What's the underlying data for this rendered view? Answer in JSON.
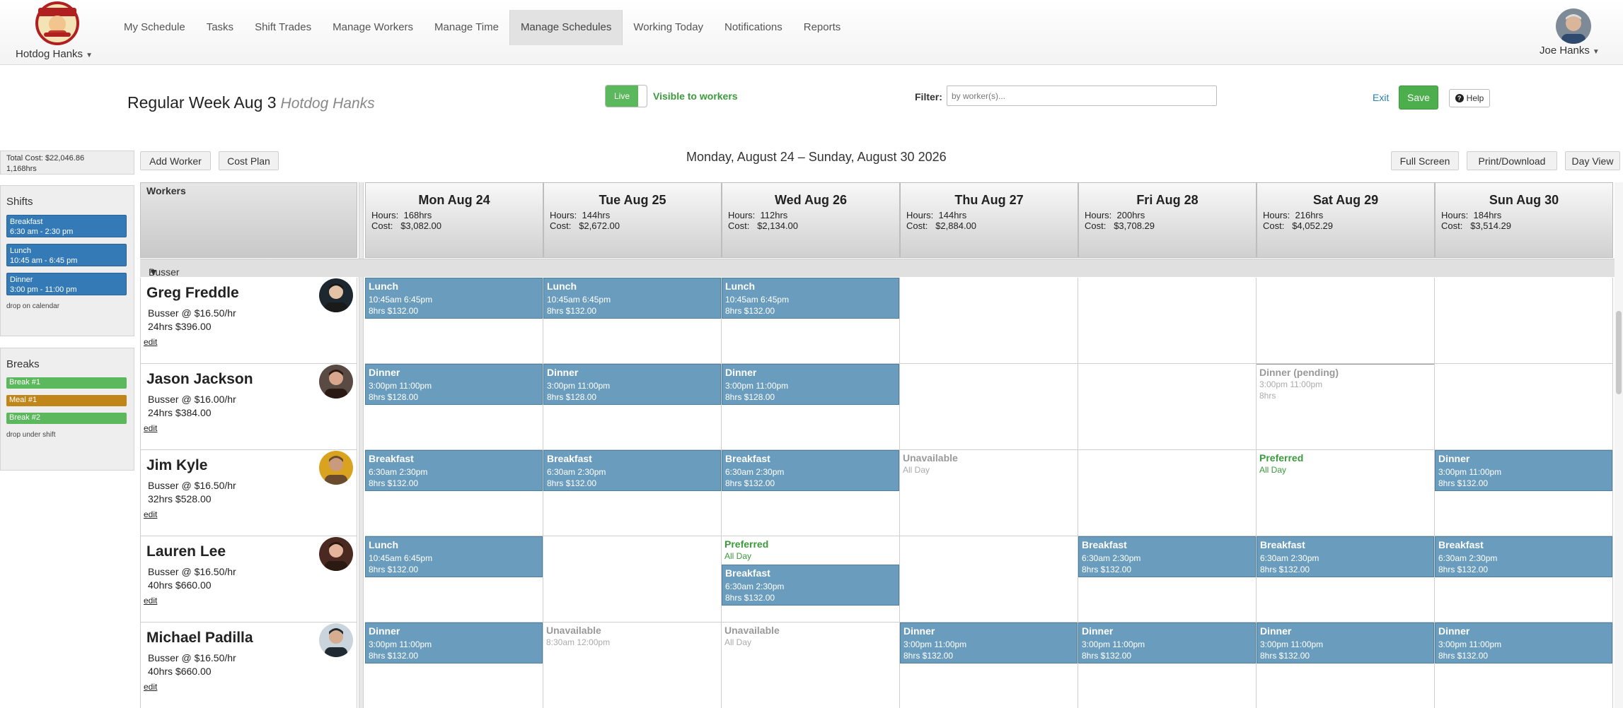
{
  "nav": {
    "brand": "Hotdog Hanks",
    "links": [
      "My Schedule",
      "Tasks",
      "Shift Trades",
      "Manage Workers",
      "Manage Time",
      "Manage Schedules",
      "Working Today",
      "Notifications",
      "Reports"
    ],
    "active_index": 5,
    "user": "Joe Hanks"
  },
  "titlebar": {
    "title": "Regular Week Aug 3",
    "subtitle": "Hotdog Hanks",
    "live_label": "Live",
    "visible_label": "Visible to workers",
    "filter_label": "Filter:",
    "filter_placeholder": "by worker(s)...",
    "exit_label": "Exit",
    "save_label": "Save",
    "help_label": "Help"
  },
  "sidebar": {
    "total_cost": "Total Cost: $22,046.86",
    "total_hours": "1,168hrs",
    "shifts_title": "Shifts",
    "shifts": [
      {
        "name": "Breakfast",
        "time": "6:30 am - 2:30 pm"
      },
      {
        "name": "Lunch",
        "time": "10:45 am - 6:45 pm"
      },
      {
        "name": "Dinner",
        "time": "3:00 pm - 11:00 pm"
      }
    ],
    "shifts_hint": "drop on calendar",
    "breaks_title": "Breaks",
    "breaks": [
      {
        "name": "Break #1",
        "color": "#5cb85c"
      },
      {
        "name": "Meal #1",
        "color": "#c0861a"
      },
      {
        "name": "Break #2",
        "color": "#5cb85c"
      }
    ],
    "breaks_hint": "drop under shift"
  },
  "toolbar": {
    "add_worker": "Add Worker",
    "cost_plan": "Cost Plan",
    "date_range": "Monday, August 24 – Sunday, August 30 2026",
    "full_screen": "Full Screen",
    "print_download": "Print/Download",
    "day_view": "Day View"
  },
  "grid": {
    "workers_header": "Workers",
    "group": "Busser",
    "days": [
      {
        "name": "Mon Aug 24",
        "hours": "168hrs",
        "cost": "$3,082.00"
      },
      {
        "name": "Tue Aug 25",
        "hours": "144hrs",
        "cost": "$2,672.00"
      },
      {
        "name": "Wed Aug 26",
        "hours": "112hrs",
        "cost": "$2,134.00"
      },
      {
        "name": "Thu Aug 27",
        "hours": "144hrs",
        "cost": "$2,884.00"
      },
      {
        "name": "Fri Aug 28",
        "hours": "200hrs",
        "cost": "$3,708.29"
      },
      {
        "name": "Sat Aug 29",
        "hours": "216hrs",
        "cost": "$4,052.29"
      },
      {
        "name": "Sun Aug 30",
        "hours": "184hrs",
        "cost": "$3,514.29"
      }
    ],
    "workers": [
      {
        "name": "Greg Freddle",
        "role": "Busser @ $16.50/hr",
        "total": "24hrs $396.00",
        "edit": "edit",
        "days": [
          [
            {
              "kind": "shift",
              "title": "Lunch",
              "line1": "10:45am 6:45pm",
              "line2": "8hrs $132.00"
            }
          ],
          [
            {
              "kind": "shift",
              "title": "Lunch",
              "line1": "10:45am 6:45pm",
              "line2": "8hrs $132.00"
            }
          ],
          [
            {
              "kind": "shift",
              "title": "Lunch",
              "line1": "10:45am 6:45pm",
              "line2": "8hrs $132.00"
            }
          ],
          [],
          [],
          [],
          []
        ]
      },
      {
        "name": "Jason Jackson",
        "role": "Busser @ $16.00/hr",
        "total": "24hrs $384.00",
        "edit": "edit",
        "days": [
          [
            {
              "kind": "shift",
              "title": "Dinner",
              "line1": "3:00pm 11:00pm",
              "line2": "8hrs $128.00"
            }
          ],
          [
            {
              "kind": "shift",
              "title": "Dinner",
              "line1": "3:00pm 11:00pm",
              "line2": "8hrs $128.00"
            }
          ],
          [
            {
              "kind": "shift",
              "title": "Dinner",
              "line1": "3:00pm 11:00pm",
              "line2": "8hrs $128.00"
            }
          ],
          [],
          [],
          [
            {
              "kind": "pending",
              "title": "Dinner (pending)",
              "line1": "3:00pm 11:00pm",
              "line2": "8hrs"
            }
          ],
          []
        ]
      },
      {
        "name": "Jim Kyle",
        "role": "Busser @ $16.50/hr",
        "total": "32hrs $528.00",
        "edit": "edit",
        "days": [
          [
            {
              "kind": "shift",
              "title": "Breakfast",
              "line1": "6:30am 2:30pm",
              "line2": "8hrs $132.00"
            }
          ],
          [
            {
              "kind": "shift",
              "title": "Breakfast",
              "line1": "6:30am 2:30pm",
              "line2": "8hrs $132.00"
            }
          ],
          [
            {
              "kind": "shift",
              "title": "Breakfast",
              "line1": "6:30am 2:30pm",
              "line2": "8hrs $132.00"
            }
          ],
          [
            {
              "kind": "unavail",
              "title": "Unavailable",
              "line1": "All Day",
              "line2": ""
            }
          ],
          [],
          [
            {
              "kind": "pref",
              "title": "Preferred",
              "line1": "All Day",
              "line2": ""
            }
          ],
          [
            {
              "kind": "shift",
              "title": "Dinner",
              "line1": "3:00pm 11:00pm",
              "line2": "8hrs $132.00"
            }
          ]
        ]
      },
      {
        "name": "Lauren Lee",
        "role": "Busser @ $16.50/hr",
        "total": "40hrs $660.00",
        "edit": "edit",
        "days": [
          [
            {
              "kind": "shift",
              "title": "Lunch",
              "line1": "10:45am 6:45pm",
              "line2": "8hrs $132.00"
            }
          ],
          [],
          [
            {
              "kind": "pref",
              "title": "Preferred",
              "line1": "All Day",
              "line2": ""
            },
            {
              "kind": "shift",
              "title": "Breakfast",
              "line1": "6:30am 2:30pm",
              "line2": "8hrs $132.00"
            }
          ],
          [],
          [
            {
              "kind": "shift",
              "title": "Breakfast",
              "line1": "6:30am 2:30pm",
              "line2": "8hrs $132.00"
            }
          ],
          [
            {
              "kind": "shift",
              "title": "Breakfast",
              "line1": "6:30am 2:30pm",
              "line2": "8hrs $132.00"
            }
          ],
          [
            {
              "kind": "shift",
              "title": "Breakfast",
              "line1": "6:30am 2:30pm",
              "line2": "8hrs $132.00"
            }
          ]
        ]
      },
      {
        "name": "Michael Padilla",
        "role": "Busser @ $16.50/hr",
        "total": "40hrs $660.00",
        "edit": "edit",
        "days": [
          [
            {
              "kind": "shift",
              "title": "Dinner",
              "line1": "3:00pm 11:00pm",
              "line2": "8hrs $132.00"
            }
          ],
          [
            {
              "kind": "unavail",
              "title": "Unavailable",
              "line1": "8:30am 12:00pm",
              "line2": ""
            }
          ],
          [
            {
              "kind": "unavail",
              "title": "Unavailable",
              "line1": "All Day",
              "line2": ""
            }
          ],
          [
            {
              "kind": "shift",
              "title": "Dinner",
              "line1": "3:00pm 11:00pm",
              "line2": "8hrs $132.00"
            }
          ],
          [
            {
              "kind": "shift",
              "title": "Dinner",
              "line1": "3:00pm 11:00pm",
              "line2": "8hrs $132.00"
            }
          ],
          [
            {
              "kind": "shift",
              "title": "Dinner",
              "line1": "3:00pm 11:00pm",
              "line2": "8hrs $132.00"
            }
          ],
          [
            {
              "kind": "shift",
              "title": "Dinner",
              "line1": "3:00pm 11:00pm",
              "line2": "8hrs $132.00"
            }
          ]
        ]
      }
    ]
  }
}
